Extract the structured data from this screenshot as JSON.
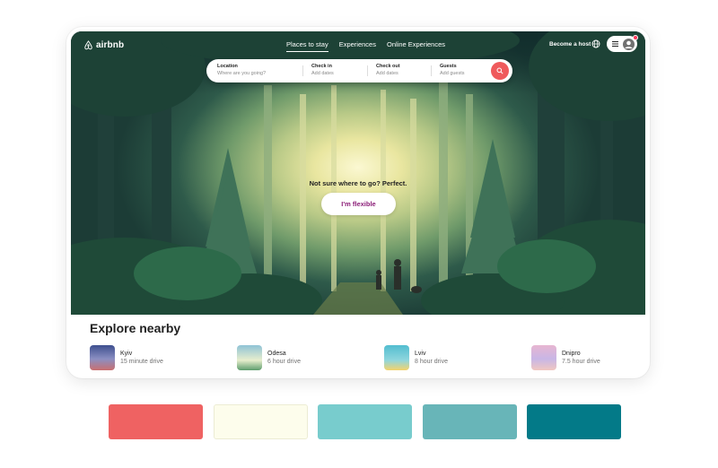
{
  "brand": {
    "name": "airbnb"
  },
  "nav": {
    "tabs": [
      {
        "label": "Places to stay",
        "active": true
      },
      {
        "label": "Experiences",
        "active": false
      },
      {
        "label": "Online Experiences",
        "active": false
      }
    ],
    "become_host": "Become a host",
    "icons": {
      "globe": "globe-icon",
      "menu": "hamburger-icon",
      "user": "user-avatar-icon"
    }
  },
  "search": {
    "location": {
      "label": "Location",
      "placeholder": "Where are you going?"
    },
    "checkin": {
      "label": "Check in",
      "placeholder": "Add dates"
    },
    "checkout": {
      "label": "Check out",
      "placeholder": "Add dates"
    },
    "guests": {
      "label": "Guests",
      "placeholder": "Add guests"
    },
    "button_icon": "search-icon"
  },
  "hero": {
    "tagline": "Not sure where to go? Perfect.",
    "cta": "I'm flexible"
  },
  "explore": {
    "title": "Explore nearby",
    "places": [
      {
        "name": "Kyiv",
        "time": "15 minute drive"
      },
      {
        "name": "Odesa",
        "time": "6 hour drive"
      },
      {
        "name": "Lviv",
        "time": "8 hour drive"
      },
      {
        "name": "Dnipro",
        "time": "7.5 hour drive"
      }
    ]
  },
  "palette": [
    "#ef6262",
    "#fdfdec",
    "#78cccd",
    "#68b5b8",
    "#037a88"
  ],
  "colors": {
    "accent": "#ef5a5c",
    "cta_text": "#8b1d77"
  }
}
